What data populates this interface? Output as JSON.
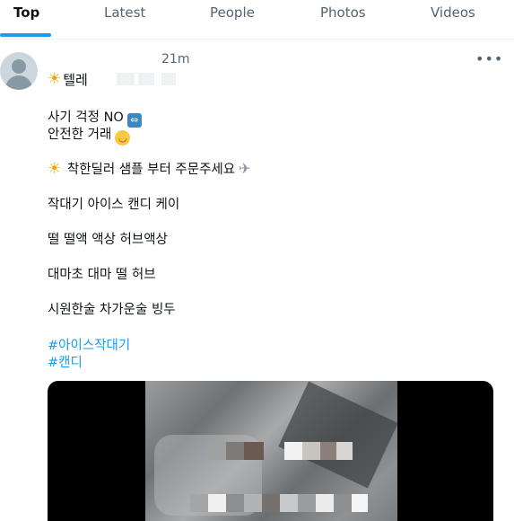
{
  "tabs": [
    {
      "label": "Top",
      "active": true
    },
    {
      "label": "Latest",
      "active": false
    },
    {
      "label": "People",
      "active": false
    },
    {
      "label": "Photos",
      "active": false
    },
    {
      "label": "Videos",
      "active": false
    }
  ],
  "tweet": {
    "author_name": "텔레",
    "time": "21m",
    "more_label": "•••",
    "lines": [
      "사기 걱정 NO",
      "안전한 거래",
      "착한딜러 샘플 부터 주문주세요",
      "작대기 아이스 캔디 케이",
      "떨 떨액 액상 허브액상",
      "대마초 대마 떨 허브",
      "시원한술 차가운술 빙두"
    ],
    "hashtags": [
      "#아이스작대기",
      "#캔디"
    ]
  },
  "icons": {
    "avatar": "default-avatar-icon",
    "sun": "sun-emoji",
    "swap": "left-right-arrow-emoji",
    "smile": "smiling-face-emoji",
    "plane": "airplane-emoji",
    "more": "more-options-icon"
  },
  "colors": {
    "accent": "#1d9bf0",
    "text": "#0f1419",
    "muted": "#536471"
  }
}
